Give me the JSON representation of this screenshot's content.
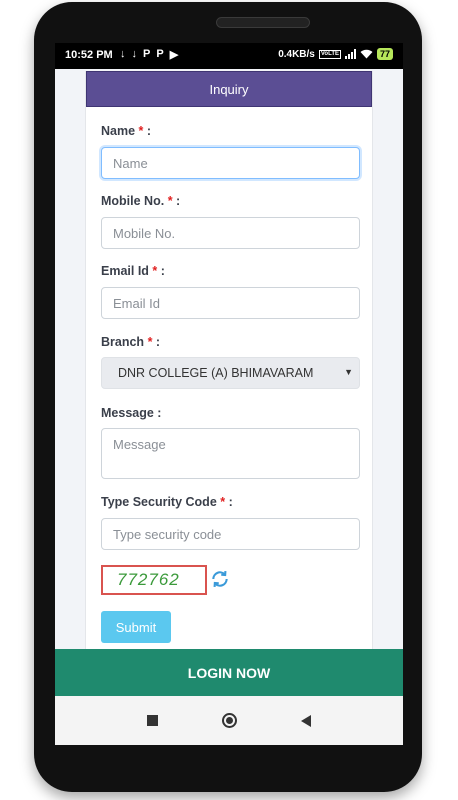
{
  "status_bar": {
    "time": "10:52 PM",
    "net_speed": "0.4KB/s",
    "volte": "VoLTE",
    "battery": "77",
    "left_icons": [
      "↓",
      "↓",
      "P",
      "P",
      "▶"
    ]
  },
  "form": {
    "title": "Inquiry",
    "name": {
      "label": "Name",
      "required": "*",
      "colon": ":",
      "placeholder": "Name"
    },
    "mobile": {
      "label": "Mobile No.",
      "required": "*",
      "colon": ":",
      "placeholder": "Mobile No."
    },
    "email": {
      "label": "Email Id",
      "required": "*",
      "colon": ":",
      "placeholder": "Email Id"
    },
    "branch": {
      "label": "Branch",
      "required": "*",
      "colon": ":",
      "selected": "DNR COLLEGE (A) BHIMAVARAM"
    },
    "message": {
      "label": "Message :",
      "placeholder": "Message"
    },
    "security": {
      "label": "Type Security Code",
      "required": "*",
      "colon": ":",
      "placeholder": "Type security code"
    },
    "captcha_code": "772762",
    "submit_label": "Submit"
  },
  "login_label": "LOGIN NOW",
  "colors": {
    "header_bg": "#5b4e94",
    "login_bg": "#1f8a6e",
    "submit_bg": "#5bc8ef",
    "required": "#e02020",
    "captcha_text": "#3b9a3b",
    "captcha_border": "#d9534f"
  }
}
